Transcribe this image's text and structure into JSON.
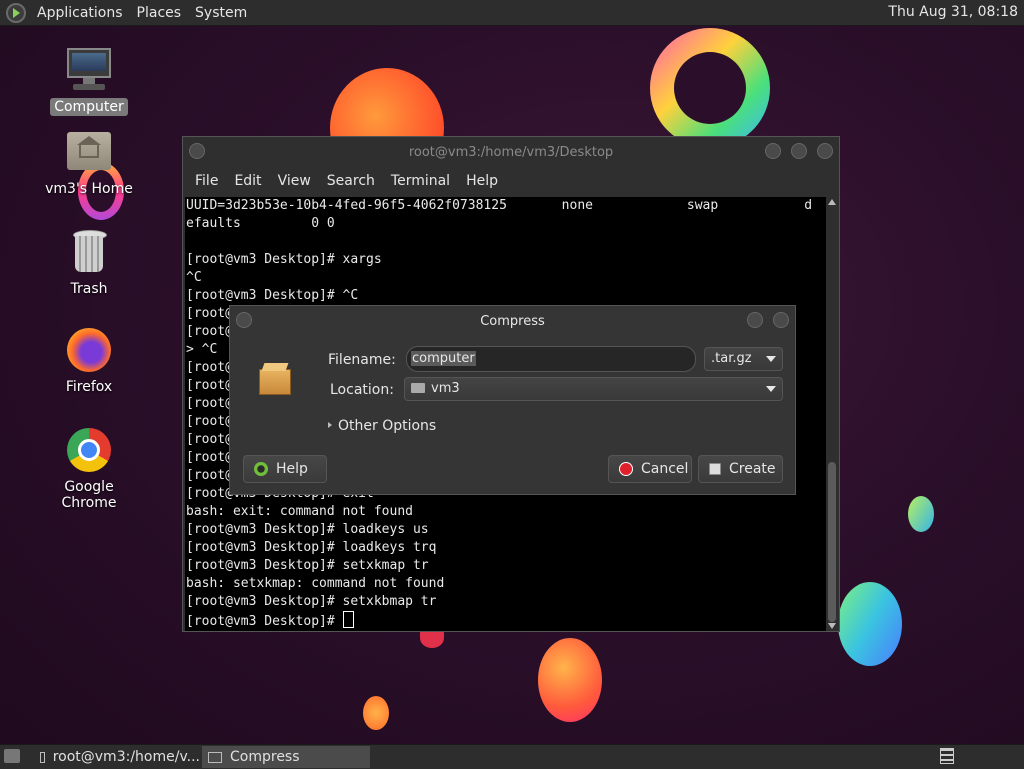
{
  "top_panel": {
    "menus": [
      "Applications",
      "Places",
      "System"
    ],
    "clock": "Thu Aug 31, 08:18"
  },
  "desktop_icons": [
    {
      "label": "Computer",
      "icon": "computer-icon"
    },
    {
      "label": "vm3's Home",
      "icon": "home-folder-icon"
    },
    {
      "label": "Trash",
      "icon": "trash-icon"
    },
    {
      "label": "Firefox",
      "icon": "firefox-icon"
    },
    {
      "label": "Google Chrome",
      "icon": "chrome-icon"
    }
  ],
  "terminal": {
    "title": "root@vm3:/home/vm3/Desktop",
    "menus": [
      "File",
      "Edit",
      "View",
      "Search",
      "Terminal",
      "Help"
    ],
    "lines": [
      "UUID=3d23b53e-10b4-4fed-96f5-4062f0738125       none            swap           d",
      "efaults         0 0",
      "",
      "[root@vm3 Desktop]# xargs",
      "^C",
      "[root@vm3 Desktop]# ^C",
      "[root@",
      "[root@",
      "> ^C",
      "[root@",
      "[root@",
      "[root@",
      "[root@",
      "[root@",
      "[root@",
      "[root@",
      "[root@vm3 Desktop]# exit",
      "bash: exit: command not found",
      "[root@vm3 Desktop]# loadkeys us",
      "[root@vm3 Desktop]# loadkeys trq",
      "[root@vm3 Desktop]# setxkmap tr",
      "bash: setxkmap: command not found",
      "[root@vm3 Desktop]# setxkbmap tr",
      "[root@vm3 Desktop]# "
    ]
  },
  "compress_dialog": {
    "title": "Compress",
    "filename_label": "Filename:",
    "filename_value": "computer",
    "extension": ".tar.gz",
    "location_label": "Location:",
    "location_value": "vm3",
    "other_options": "Other Options",
    "help": "Help",
    "cancel": "Cancel",
    "create": "Create"
  },
  "taskbar": {
    "tasks": [
      "root@vm3:/home/v...",
      "Compress"
    ]
  },
  "colors": {
    "desktop_bg": "#2b0f2a",
    "panel_bg": "#2d2d2d",
    "terminal_bg": "#000000",
    "cancel_icon": "#e0202a",
    "help_icon": "#6fbf3a"
  }
}
